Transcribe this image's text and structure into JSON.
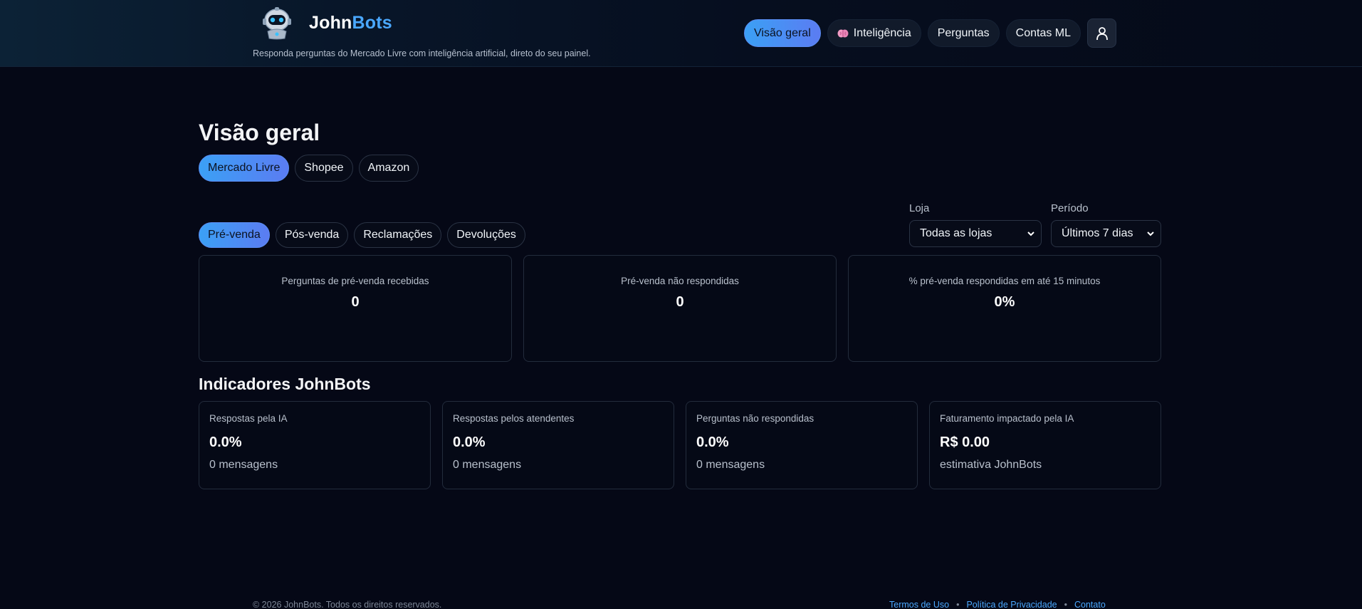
{
  "header": {
    "brand_first": "John",
    "brand_second": "Bots",
    "tagline": "Responda perguntas do Mercado Livre com inteligência artificial, direto do seu painel.",
    "nav": [
      {
        "label": "Visão geral",
        "active": true
      },
      {
        "label": "Inteligência",
        "icon": "brain-icon"
      },
      {
        "label": "Perguntas"
      },
      {
        "label": "Contas ML"
      }
    ],
    "user_icon": "user-icon"
  },
  "main": {
    "title": "Visão geral",
    "marketplace_tabs": [
      "Mercado Livre",
      "Shopee",
      "Amazon"
    ],
    "sub_tabs": [
      "Pré-venda",
      "Pós-venda",
      "Reclamações",
      "Devoluções"
    ],
    "filters": {
      "store_label": "Loja",
      "store_value": "Todas as lojas",
      "period_label": "Período",
      "period_value": "Últimos 7 dias"
    },
    "stats": [
      {
        "label": "Perguntas de pré-venda recebidas",
        "value": "0"
      },
      {
        "label": "Pré-venda não respondidas",
        "value": "0"
      },
      {
        "label": "% pré-venda respondidas em até 15 minutos",
        "value": "0%"
      }
    ],
    "indicators_title": "Indicadores JohnBots",
    "indicators": [
      {
        "label": "Respostas pela IA",
        "value": "0.0%",
        "sub": "0 mensagens"
      },
      {
        "label": "Respostas pelos atendentes",
        "value": "0.0%",
        "sub": "0 mensagens"
      },
      {
        "label": "Perguntas não respondidas",
        "value": "0.0%",
        "sub": "0 mensagens"
      },
      {
        "label": "Faturamento impactado pela IA",
        "value": "R$ 0.00",
        "sub": "estimativa JohnBots"
      }
    ]
  },
  "footer": {
    "copyright": "© 2026 JohnBots. Todos os direitos reservados.",
    "links": [
      "Termos de Uso",
      "Política de Privacidade",
      "Contato"
    ],
    "separator": "•"
  },
  "colors": {
    "background": "#050816",
    "accent": "#4aa8ff",
    "accent_gradient_end": "#5b7cf2"
  }
}
